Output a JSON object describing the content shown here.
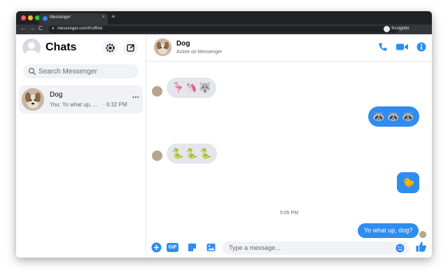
{
  "browser": {
    "tab_title": "Messenger",
    "tab_close": "×",
    "new_tab": "+",
    "url": "messenger.com/t/ruffme",
    "profile_label": "Incognito",
    "back": "←",
    "forward": "→",
    "reload": "C",
    "url_icons": "⌕ ☆"
  },
  "sidebar": {
    "title": "Chats",
    "search_placeholder": "Search Messenger",
    "conversations": [
      {
        "name": "Dog",
        "preview": "You: Yo what up, ...",
        "time": "· 6:32 PM",
        "more": "···"
      }
    ]
  },
  "chat": {
    "contact_name": "Dog",
    "contact_status": "Active on Messenger",
    "messages": [
      {
        "from": "them",
        "kind": "stickers",
        "glyphs": [
          "🦩",
          "🦄",
          "🐺"
        ]
      },
      {
        "from": "me",
        "kind": "stickers",
        "glyphs": [
          "🦝",
          "🦝",
          "🦝"
        ]
      },
      {
        "from": "them",
        "kind": "stickers",
        "glyphs": [
          "🐍",
          "🐍",
          "🐍"
        ]
      },
      {
        "from": "me",
        "kind": "sticker",
        "glyphs": [
          "🐤"
        ]
      },
      {
        "from": "system",
        "kind": "timestamp",
        "text": "5:05 PM"
      },
      {
        "from": "me",
        "kind": "text",
        "text": "Yo what up, dog?"
      }
    ]
  },
  "composer": {
    "placeholder": "Type a message...",
    "gif_label": "GIF"
  },
  "colors": {
    "accent": "#2f8cf0",
    "incoming_bubble": "#e4e6eb",
    "chrome_dark": "#202124"
  },
  "icons": [
    "gear-icon",
    "compose-icon",
    "search-icon",
    "phone-icon",
    "video-icon",
    "info-icon",
    "plus-icon",
    "gif-icon",
    "sticker-icon",
    "image-icon",
    "emoji-icon",
    "like-icon"
  ]
}
